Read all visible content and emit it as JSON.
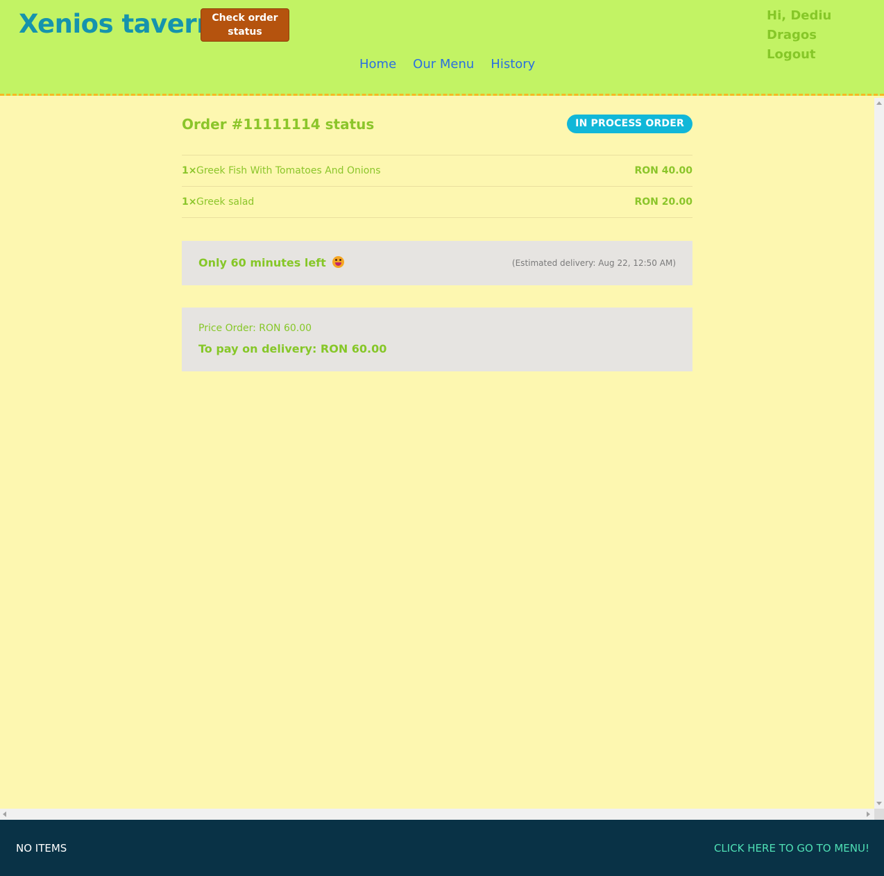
{
  "header": {
    "brand": "Xenios taverna",
    "check_order_button": "Check order status",
    "greeting": "Hi, Dediu Dragos",
    "logout": "Logout",
    "nav": [
      "Home",
      "Our Menu",
      "History"
    ]
  },
  "order": {
    "title": "Order #11111114 status",
    "status_badge": "IN PROCESS ORDER",
    "items": [
      {
        "qty": "1×",
        "name": "Greek Fish With Tomatoes And Onions",
        "price": "RON 40.00"
      },
      {
        "qty": "1×",
        "name": "Greek salad",
        "price": "RON 20.00"
      }
    ],
    "time_left": "Only 60 minutes left",
    "estimated_delivery": "(Estimated delivery: Aug 22, 12:50 AM)",
    "price_order": "Price Order: RON 60.00",
    "to_pay": "To pay on delivery: RON 60.00"
  },
  "footer": {
    "cart_status": "NO ITEMS",
    "go_to_menu": "CLICK HERE TO GO TO MENU!"
  },
  "colors": {
    "header_bg": "#c2f364",
    "page_bg": "#fdf7b0",
    "brand": "#1593ad",
    "accent_green": "#86c728",
    "status_badge": "#11b7d8",
    "check_button": "#b5530e",
    "footer_bg": "#093246"
  }
}
